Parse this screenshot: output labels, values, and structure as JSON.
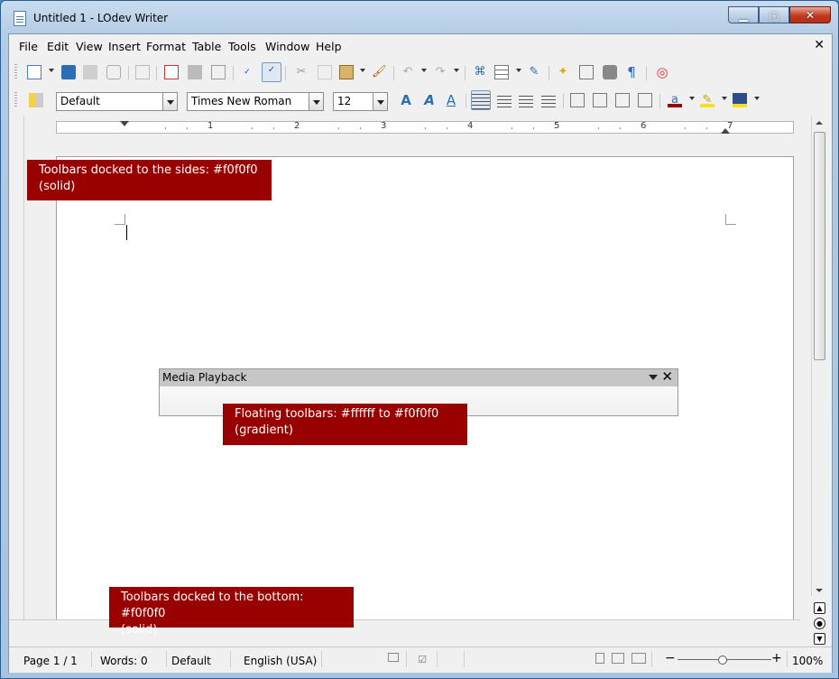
{
  "window": {
    "title": "Untitled 1 - LOdev Writer",
    "min_label": "▁",
    "max_label": "▢",
    "close_label": "✕"
  },
  "menubar": {
    "items": [
      {
        "label": "File",
        "u": "F"
      },
      {
        "label": "Edit",
        "u": "E"
      },
      {
        "label": "View",
        "u": "V"
      },
      {
        "label": "Insert",
        "u": "I"
      },
      {
        "label": "Format",
        "u": "o"
      },
      {
        "label": "Table",
        "u": "a"
      },
      {
        "label": "Tools",
        "u": "T"
      },
      {
        "label": "Window",
        "u": "W"
      },
      {
        "label": "Help",
        "u": "H"
      }
    ],
    "doc_close": "✕"
  },
  "formatting": {
    "paragraph_style": "Default",
    "font_name": "Times New Roman",
    "font_size": "12"
  },
  "ruler": {
    "labels": [
      "1",
      "2",
      "3",
      "4",
      "5",
      "6",
      "7"
    ]
  },
  "floating_toolbar": {
    "title": "Media Playback",
    "close": "✕"
  },
  "annotations": {
    "sides": {
      "line1": "Toolbars docked to the sides: #f0f0f0",
      "line2": "(solid)"
    },
    "floating": {
      "line1": "Floating toolbars: #ffffff to #f0f0f0",
      "line2": "(gradient)"
    },
    "bottom": {
      "line1": "Toolbars docked to the bottom: #f0f0f0",
      "line2": "(solid)"
    }
  },
  "statusbar": {
    "page": "Page 1 / 1",
    "words": "Words: 0",
    "style": "Default",
    "language": "English (USA)",
    "zoom": "100%"
  },
  "colors": {
    "annotation_bg": "#990000",
    "toolbar_bg": "#f0f0f0",
    "floating_toolbar_gradient": [
      "#ffffff",
      "#f0f0f0"
    ]
  }
}
